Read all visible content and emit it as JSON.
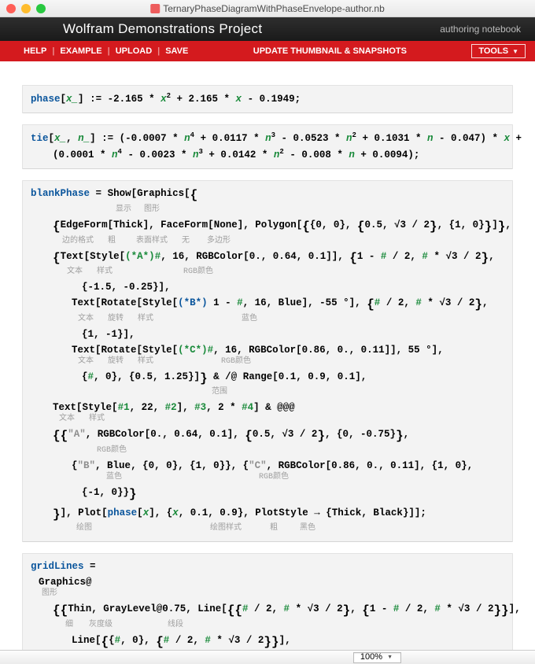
{
  "window": {
    "filename": "TernaryPhaseDiagramWithPhaseEnvelope-author.nb"
  },
  "banner": {
    "title_prefix": "Wolfram",
    "title_main": " Demonstrations Project",
    "subtitle": "authoring notebook"
  },
  "toolbar": {
    "help": "HELP",
    "example": "EXAMPLE",
    "upload": "UPLOAD",
    "save": "SAVE",
    "update": "UPDATE THUMBNAIL  & SNAPSHOTS",
    "tools": "TOOLS",
    "tools_arrow": "▼"
  },
  "code": {
    "phase_def": "phase",
    "tie_def": "tie",
    "blank_def": "blankPhase",
    "grid_def": "gridLines",
    "set_delayed": ":=",
    "set": "=",
    "phase_body_a": "-2.165",
    "phase_body_b": "2.165",
    "phase_body_c": "0.1949",
    "tie_c1": "-0.0007",
    "tie_c2": "0.0117",
    "tie_c3": "0.0523",
    "tie_c4": "0.1031",
    "tie_c5": "0.047",
    "tie_c6": "0.0001",
    "tie_c7": "0.0023",
    "tie_c8": "0.0142",
    "tie_c9": "0.008",
    "tie_c10": "0.0094",
    "show": "Show",
    "graphics": "Graphics",
    "edgeform": "EdgeForm",
    "thick": "Thick",
    "faceform": "FaceForm",
    "none": "None",
    "polygon": "Polygon",
    "text": "Text",
    "style": "Style",
    "rgbcolor": "RGBColor",
    "rotate": "Rotate",
    "blue": "Blue",
    "range": "Range",
    "plot": "Plot",
    "plotstyle": "PlotStyle",
    "black": "Black",
    "thin": "Thin",
    "graylevel": "GrayLevel@0.75",
    "line": "Line",
    "range_args": "0.1, 0.9, 0.1",
    "rgb_a": "0., 0.64, 0.1",
    "rgb_c": "0.86, 0., 0.11",
    "txt_a": "\"A\"",
    "txt_b": "\"B\"",
    "txt_c": "\"C\"",
    "cn_show": "显示",
    "cn_graphics": "图形",
    "cn_edgeform": "边的格式",
    "cn_thick": "粗",
    "cn_faceform": "表面样式",
    "cn_none": "无",
    "cn_polygon": "多边形",
    "cn_text": "文本",
    "cn_style": "样式",
    "cn_rgb": "RGB颜色",
    "cn_rotate": "旋转",
    "cn_blue": "蓝色",
    "cn_range": "范围",
    "cn_plot": "绘图",
    "cn_plotstyle": "绘图样式",
    "cn_black": "黑色",
    "cn_thin": "细",
    "cn_gray": "灰度级",
    "cn_line": "线段"
  },
  "status": {
    "zoom": "100%"
  }
}
